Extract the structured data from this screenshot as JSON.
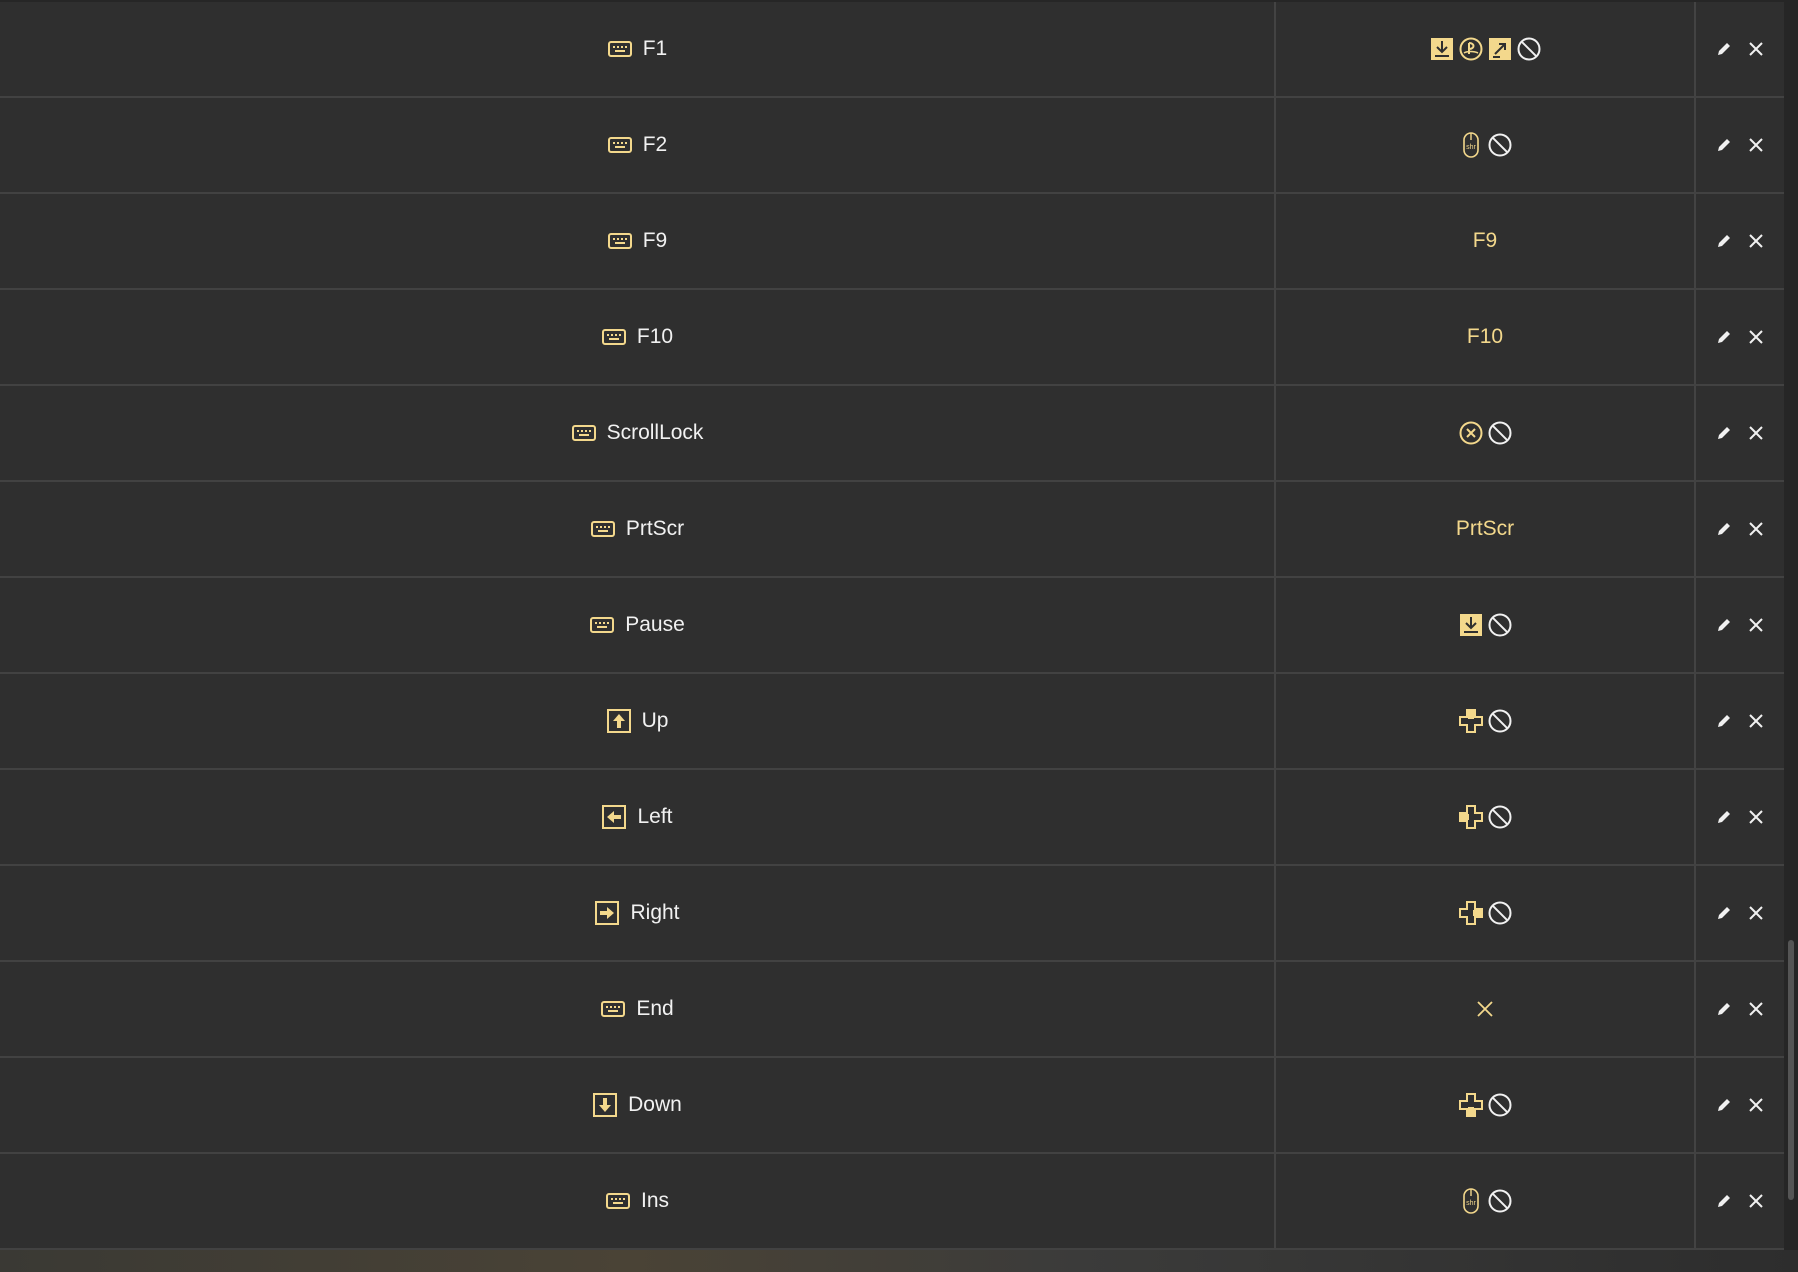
{
  "colors": {
    "background": "#2f2f2f",
    "divider": "#424242",
    "key_text": "#f1f1f1",
    "mapping_accent": "#f3d88c"
  },
  "rows": [
    {
      "key": "F1",
      "key_icon": "keyboard-icon",
      "mapping": {
        "type": "icons",
        "icons": [
          "download-box-icon",
          "playstation-icon",
          "share-box-icon",
          "disabled-icon"
        ]
      }
    },
    {
      "key": "F2",
      "key_icon": "keyboard-icon",
      "mapping": {
        "type": "icons",
        "icons": [
          "mouse-shift-icon",
          "disabled-icon"
        ]
      }
    },
    {
      "key": "F9",
      "key_icon": "keyboard-icon",
      "mapping": {
        "type": "text",
        "text": "F9"
      }
    },
    {
      "key": "F10",
      "key_icon": "keyboard-icon",
      "mapping": {
        "type": "text",
        "text": "F10"
      }
    },
    {
      "key": "ScrollLock",
      "key_icon": "keyboard-icon",
      "mapping": {
        "type": "icons",
        "icons": [
          "circle-x-icon",
          "disabled-icon"
        ]
      }
    },
    {
      "key": "PrtScr",
      "key_icon": "keyboard-icon",
      "mapping": {
        "type": "text",
        "text": "PrtScr"
      }
    },
    {
      "key": "Pause",
      "key_icon": "keyboard-icon",
      "mapping": {
        "type": "icons",
        "icons": [
          "download-box-icon",
          "disabled-icon"
        ]
      }
    },
    {
      "key": "Up",
      "key_icon": "arrow-up-key-icon",
      "mapping": {
        "type": "icons",
        "icons": [
          "dpad-up-icon",
          "disabled-icon"
        ]
      }
    },
    {
      "key": "Left",
      "key_icon": "arrow-left-key-icon",
      "mapping": {
        "type": "icons",
        "icons": [
          "dpad-left-icon",
          "disabled-icon"
        ]
      }
    },
    {
      "key": "Right",
      "key_icon": "arrow-right-key-icon",
      "mapping": {
        "type": "icons",
        "icons": [
          "dpad-right-icon",
          "disabled-icon"
        ]
      }
    },
    {
      "key": "End",
      "key_icon": "keyboard-icon",
      "mapping": {
        "type": "icons",
        "icons": [
          "x-icon"
        ]
      }
    },
    {
      "key": "Down",
      "key_icon": "arrow-down-key-icon",
      "mapping": {
        "type": "icons",
        "icons": [
          "dpad-down-icon",
          "disabled-icon"
        ]
      }
    },
    {
      "key": "Ins",
      "key_icon": "keyboard-icon",
      "mapping": {
        "type": "icons",
        "icons": [
          "mouse-shift-icon",
          "disabled-icon"
        ]
      }
    }
  ],
  "row_actions": [
    "edit-icon",
    "delete-icon"
  ]
}
